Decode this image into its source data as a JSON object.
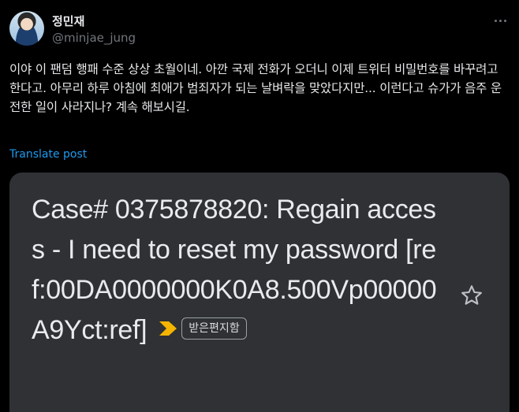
{
  "author": {
    "display_name": "정민재",
    "handle": "@minjae_jung"
  },
  "tweet": {
    "text": "이야 이 팬덤 행패 수준 상상 초월이네. 아깐 국제 전화가 오더니 이제 트위터 비밀번호를 바꾸려고 한다고. 아무리 하루 아침에 최애가 범죄자가 되는 날벼락을 맞았다지만... 이런다고 슈가가 음주 운전한 일이 사라지나? 계속 해보시길.",
    "translate_label": "Translate post"
  },
  "email": {
    "subject": "Case# 0375878820: Regain access - I need to reset my password [ref:00DA0000000K0A8.500Vp00000A9Yct:ref]",
    "label": "받은편지함"
  },
  "icons": {
    "more": "more-horizontal-icon",
    "star": "star-outline-icon",
    "importance": "importance-arrow-icon"
  },
  "colors": {
    "background": "#000000",
    "media_background": "#303134",
    "link": "#1d9bf0",
    "importance_arrow": "#f4b400"
  }
}
